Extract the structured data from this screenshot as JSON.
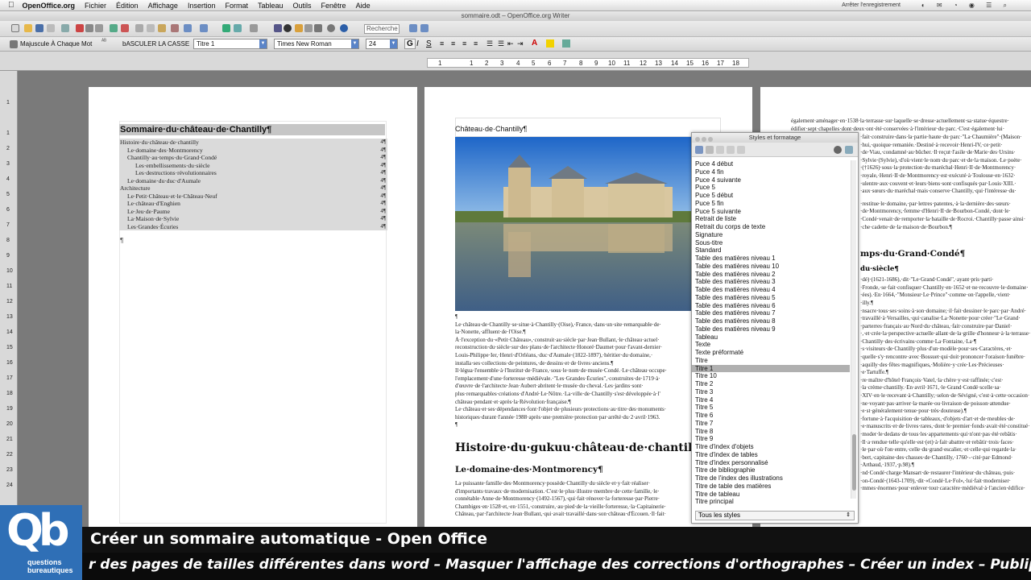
{
  "menubar": {
    "app": "OpenOffice.org",
    "items": [
      "Fichier",
      "Édition",
      "Affichage",
      "Insertion",
      "Format",
      "Tableau",
      "Outils",
      "Fenêtre",
      "Aide"
    ],
    "record": "Arrêter l'enregistrement"
  },
  "window": {
    "title": "sommaire.odt – OpenOffice.org Writer"
  },
  "toolbar": {
    "search_placeholder": "Recherche"
  },
  "format_bar": {
    "majuscule": "Majuscule À Chaque Mot",
    "basculer": "bASCULER LA CASSE",
    "style_value": "Titre 1",
    "font_value": "Times New Roman",
    "size_value": "24"
  },
  "ruler": {
    "h_numbers": [
      "1",
      "1",
      "2",
      "3",
      "4",
      "5",
      "6",
      "7",
      "8",
      "9",
      "10",
      "11",
      "12",
      "13",
      "14",
      "15",
      "16",
      "17",
      "18"
    ],
    "v_numbers": [
      "1",
      "1",
      "2",
      "3",
      "4",
      "5",
      "6",
      "7",
      "8",
      "9",
      "10",
      "11",
      "12",
      "13",
      "14",
      "15",
      "16",
      "17",
      "18",
      "19",
      "20",
      "21",
      "22",
      "23",
      "24"
    ]
  },
  "page1": {
    "toc_title": "Sommaire·du·château·de·Chantilly¶",
    "toc_items": [
      {
        "text": "Histoire·du·château·de·chantilly",
        "page": "4¶"
      },
      {
        "text": "Le·domaine·des·Montmorency",
        "page": "4¶"
      },
      {
        "text": "Chantilly·au·temps·du·Grand·Condé",
        "page": "4¶"
      },
      {
        "text": "Les·embellissements·du·siècle",
        "page": "4¶"
      },
      {
        "text": "Les·destructions·révolutionnaires",
        "page": "4¶"
      },
      {
        "text": "Le·domaine·du·duc·d'Aumale",
        "page": "4¶"
      },
      {
        "text": "Architecture",
        "page": "4¶"
      },
      {
        "text": "Le·Petit·Château·et·le·Château·Neuf",
        "page": "4¶"
      },
      {
        "text": "Le·château·d'Enghien",
        "page": "4¶"
      },
      {
        "text": "Le·Jeu·de·Paume",
        "page": "4¶"
      },
      {
        "text": "La·Maison·de·Sylvie",
        "page": "4¶"
      },
      {
        "text": "Les·Grandes·Écuries",
        "page": "4¶"
      }
    ],
    "empty_para": "¶"
  },
  "page2": {
    "header": "Château·de·Chantilly¶",
    "paragraphs": [
      "¶",
      "Le·château·de·Chantilly·se·situe·à·Chantilly·(Oise),·France,·dans·un·site·remarquable·de·",
      "la·Nonette,·affluent·de·l'Oise.¶",
      "À·l'exception·du·«Petit·Château»,·construit·au·siècle·par·Jean·Bullant,·le·château·actuel·",
      "reconstruction·du·siècle·sur·des·plans·de·l'architecte·Honoré·Daumet·pour·l'avant-dernier·",
      "Louis-Philippe·Ier,·Henri·d'Orléans,·duc·d'Aumale·(1822-1897),·héritier·du·domaine,·",
      "installa·ses·collections·de·peintures,·de·dessins·et·de·livres·anciens.¶",
      "Il·légua·l'ensemble·à·l'Institut·de·France,·sous·le·nom·de·musée·Condé.·Le·château·occupe·",
      "l'emplacement·d'une·forteresse·médiévale.·\"Les·Grandes·Écuries\",·construites·de·1719·à·",
      "d'œuvre·de·l'architecte·Jean·Aubert·abritent·le·musée·du·cheval.·Les·jardins·sont·",
      "plus·remarquables·créations·d'André·Le·Nôtre.·La·ville·de·Chantilly·s'est·développée·à·l'",
      "château·pendant·et·après·la·Révolution·française.¶",
      "Le·château·et·ses·dépendances·font·l'objet·de·plusieurs·protections·au·titre·des·monuments·",
      "historiques·durant·l'année·1988·après·une·première·protection·par·arrêté·du·2·avril·1963.",
      "¶"
    ],
    "h1": "Histoire·du·gukuu·château·de·chantilly·¶",
    "h2": "Le·domaine·des·Montmorency¶",
    "paragraphs2": [
      "La·puissante·famille·des·Montmorency·possède·Chantilly·du·siècle·et·y·fait·réaliser·",
      "d'importants·travaux·de·modernisation.·C'est·le·plus·illustre·membre·de·cette·famille,·le·",
      "connétable·Anne·de·Montmorency·(1492-1567),·qui·fait·rénover·la·forteresse·par·Pierre·",
      "Chambiges·en·1528·et,·en·1551,·construire,·au·pied·de·la·vieille·forteresse,·la·Capitainerie·",
      "Château,·par·l'architecte·Jean·Bullant,·qui·avait·travaillé·dans·son·château·d'Écouen.·Il·fait·"
    ]
  },
  "page3": {
    "lines": [
      "également·aménager·en·1538·la·terrasse·sur·laquelle·se·dresse·actuellement·sa·statue·équestre·",
      "édifier·sept·chapelles·dont·deux·ont·été·conservées·à·l'intérieur·du·parc.·C'est·également·lui·",
      "·fait·construire·dans·la·partie·haute·du·parc·\"La·Chaumière\"·(Maison·",
      "·hui,·quoique·remaniée.·Destiné·à·recevoir·Henri-IV,·ce·petit·",
      "·de·Viau,·condamné·au·bûcher.·Il·reçut·l'asile·de·Marie·des·Ursins·",
      "·Sylvie·(Sylvie),·d'où·vient·le·nom·du·parc·et·de·la·maison.·Le·poète·",
      "·(†1626)·sous·la·protection·du·maréchal·Henri·II·de·Montmorency·",
      "·royale,·Henri·II·de·Montmorency·est·exécuté·à·Toulouse·en·1632·",
      "·ulentre·aux·couvent·et·leurs·biens·sont·confisqués·par·Louis·XIII.·",
      "·aux·sœurs·du·maréchal·mais·conserve·Chantilly,·qui·l'intéresse·du·",
      "·restitue·le·domaine,·par·lettres·patentes,·à·la·dernière·des·sœurs·",
      "·de·Montmorency,·femme·d'Henri·II·de·Bourbon-Condé,·dont·le·",
      "·Condé·venait·de·remporter·la·bataille·de·Rocroi.·Chantilly·passe·ainsi·",
      "·che·cadette·de·la·maison·de·Bourbon.¶"
    ],
    "h2": "mps·du·Grand·Condé¶",
    "h3": "du·siècle¶",
    "lines2": [
      "·dé)·(1621-1686),·dit·\"Le·Grand·Condé\",·ayant·pris·parti·",
      "·Fronde,·se·fait·confisquer·Chantilly·en·1652·et·ne·recouvre·le·domaine·",
      "·ées).·En·1664,·\"Monsieur·Le·Prince\"·comme·on·l'appelle,·vient·",
      "·illy.¶",
      "·nsacre·tous·ses·soins·à·son·domaine;·il·fait·dessiner·le·parc·par·André·",
      "·travaillé·à·Versailles,·qui·canalise·La·Nonette·pour·créer·\"Le·Grand·",
      "·parterres·français·au·Nord·du·château,·fait·construire·par·Daniel·",
      "·,·et·crée·la·perspective·actuelle·allant·de·la·grille·d'honneur·à·la·terrasse·",
      "·Chantilly·des·écrivains·comme·La·Fontaine,·La·¶",
      "·s·visiteurs·de·Chantilly·plus·d'un·modèle·pour·ses·Caractères,·et·",
      "·quelle·s'y·rencontre·avec·Bossuet·qui·doit·prononcer·l'oraison·funèbre·",
      "·aquilly·des·fêtes·magnifiques,·Molière·y·crée·Les·Précieuses·",
      "·e·Tartuffe.¶",
      "·re·maître·d'hôtel·François·Vatel,·la·chère·y·est·raffinée;·c'est·",
      "·la·crème·chantilly.·En·avril·1671,·le·Grand·Condé·scelle·sa·",
      "·XIV·en·le·recevant·à·Chantilly;·selon·de·Sévigné,·c'est·à·cette·occasion·",
      "·ne·voyant·pas·arriver·la·marée·ou·livraison·de·poisson·attendue·",
      "·e·st·généralement·tenue·pour·très·douteuse).¶",
      "·fortune·à·l'acquisition·de·tableaux,·d'objets·d'art·et·de·meubles·de·",
      "·e·manuscrits·et·de·livres·rares,·dont·le·premier·fonds·avait·été·constitué·",
      "·moder·le·dedans·de·tous·les·appartements·qui·n'ont·pas·été·rebâtis·",
      "·Il·a·rendue·telle·qu'elle·est·(et)·à·fait·abattre·et·rebâtir·trois·faces·",
      "·le·par·où·l'on·entre,·celle·du·grand·escalier,·et·celle·qui·regarde·la·",
      "·bert,·capitaine·des·chasses·de·Chantilly,·1760·-·cité·par·Edmond·",
      "·Arthaud,·1937,·p.98).¶",
      "·nd·Condé·charge·Mansart·de·restaurer·l'intérieur·du·château,·puis·",
      "·on-Condé·(1643-1709),·dit·«Condé·Le·Fol»,·lui·fait·moderniser·",
      "·mmes·énormes·pour·enlever·tout·caractère·médiéval·à·l'ancien·édifice·"
    ]
  },
  "styles_panel": {
    "title": "Styles et formatage",
    "items": [
      "Puce 4 début",
      "Puce 4 fin",
      "Puce 4 suivante",
      "Puce 5",
      "Puce 5 début",
      "Puce 5 fin",
      "Puce 5 suivante",
      "Retrait de liste",
      "Retrait du corps de texte",
      "Signature",
      "Sous-titre",
      "Standard",
      "Table des matières niveau 1",
      "Table des matières niveau 10",
      "Table des matières niveau 2",
      "Table des matières niveau 3",
      "Table des matières niveau 4",
      "Table des matières niveau 5",
      "Table des matières niveau 6",
      "Table des matières niveau 7",
      "Table des matières niveau 8",
      "Table des matières niveau 9",
      "Tableau",
      "Texte",
      "Texte préformaté",
      "Titre",
      "Titre 1",
      "Titre 10",
      "Titre 2",
      "Titre 3",
      "Titre 4",
      "Titre 5",
      "Titre 6",
      "Titre 7",
      "Titre 8",
      "Titre 9",
      "Titre d'index d'objets",
      "Titre d'index de tables",
      "Titre d'index personnalisé",
      "Titre de bibliographie",
      "Titre de l'index des illustrations",
      "Titre de table des matières",
      "Titre de tableau",
      "Titre principal"
    ],
    "selected_index": 26,
    "filter_value": "Tous les styles"
  },
  "overlay": {
    "logo_letters": "Qb",
    "logo_line1": "questions",
    "logo_line2": "bureautiques",
    "title": "Créer un sommaire automatique - Open Office",
    "ticker": "r des pages de tailles différentes dans word – Masquer l'affichage des corrections d'orthographes – Créer un index – Publipostage ave"
  },
  "colors": {
    "logo_blue": "#2f6fb6",
    "selection": "#b0b0b0",
    "toc_shade": "#dadada"
  }
}
